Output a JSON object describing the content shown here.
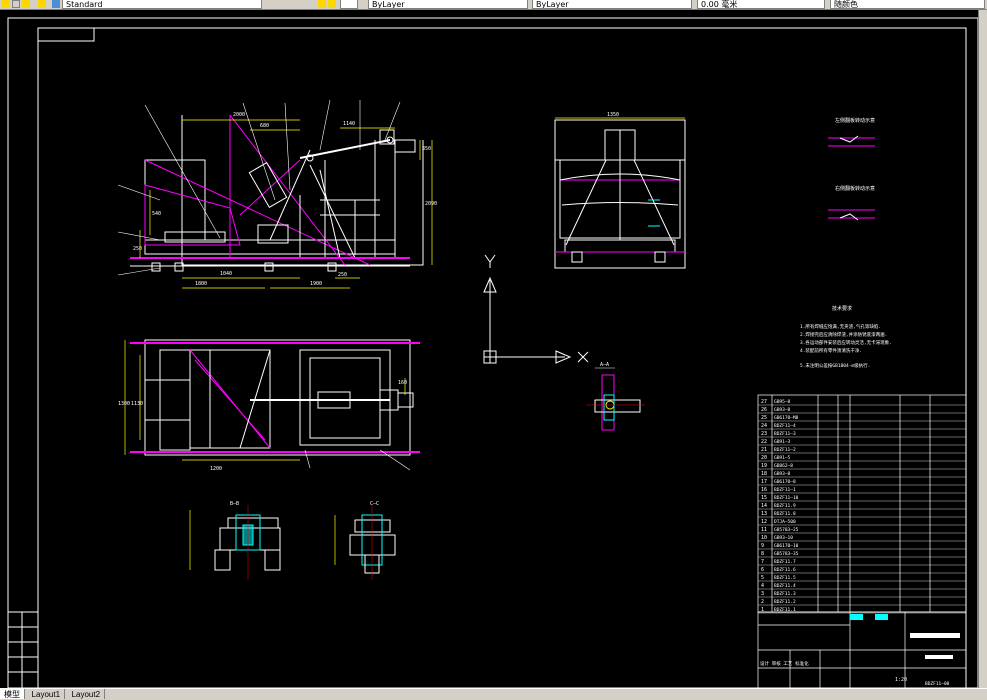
{
  "toolbar": {
    "linetype_field": "Standard",
    "layer_field": "ByLayer",
    "color_field": "ByLayer",
    "lineweight_field": "0.00 毫米",
    "plot_style_field": "随颜色"
  },
  "tabs": {
    "model": "模型",
    "layout1": "Layout1",
    "layout2": "Layout2"
  },
  "drawing": {
    "view_labels": {
      "section_aa": "A—A",
      "section_bb": "B—B",
      "section_cc": "C—C",
      "tech_req_title": "技术要求",
      "detail1_title": "左侧翻板转动示意",
      "detail2_title": "右侧翻板转动示意"
    },
    "dimensions": {
      "front_top": "2000",
      "front_mid": "680",
      "front_right": "1140",
      "front_bottom1": "1040",
      "front_bottom2": "1800",
      "front_bottom3": "1900",
      "front_bottom4": "250",
      "front_h1": "540",
      "front_h2": "250",
      "front_h3": "2090",
      "front_h4": "350",
      "side_top": "1350",
      "plan_width": "1300",
      "plan_left": "1130",
      "plan_bottom": "1200",
      "plan_right": "160"
    },
    "tech_requirements": [
      "1.所有焊缝应饱满,无夹渣,气孔等缺陷.",
      "2.焊接完后应清除焊渣,并涂防锈底漆两遍.",
      "3.各运动部件安装后应转动灵活,无卡滞现象.",
      "4.装配前所有零件须清洗干净.",
      "5.未注明公差按GB1804-m级执行."
    ],
    "bom_rows": [
      {
        "no": "27",
        "code": "GB95—8"
      },
      {
        "no": "26",
        "code": "GB93—8"
      },
      {
        "no": "25",
        "code": "GB6170—M8"
      },
      {
        "no": "24",
        "code": "BDZF11—4"
      },
      {
        "no": "23",
        "code": "BDZF11—3"
      },
      {
        "no": "22",
        "code": "GB91—3"
      },
      {
        "no": "21",
        "code": "BDZF11—2"
      },
      {
        "no": "20",
        "code": "GB91—5"
      },
      {
        "no": "19",
        "code": "GB862—8"
      },
      {
        "no": "18",
        "code": "GB93—8"
      },
      {
        "no": "17",
        "code": "GB6170—8"
      },
      {
        "no": "16",
        "code": "BDZF11—1"
      },
      {
        "no": "15",
        "code": "BDZF11—10"
      },
      {
        "no": "14",
        "code": "BDZF11.9"
      },
      {
        "no": "13",
        "code": "BDZF11.8"
      },
      {
        "no": "12",
        "code": "DTJA—500"
      },
      {
        "no": "11",
        "code": "GB5783—25"
      },
      {
        "no": "10",
        "code": "GB93—10"
      },
      {
        "no": "9",
        "code": "GB6170—10"
      },
      {
        "no": "8",
        "code": "GB5783—35"
      },
      {
        "no": "7",
        "code": "BDZF11.7"
      },
      {
        "no": "6",
        "code": "BDZF11.6"
      },
      {
        "no": "5",
        "code": "BDZF11.5"
      },
      {
        "no": "4",
        "code": "BDZF11.4"
      },
      {
        "no": "3",
        "code": "BDZF11.3"
      },
      {
        "no": "2",
        "code": "BDZF11.2"
      },
      {
        "no": "1",
        "code": "BDZF11.1"
      }
    ],
    "title_block": {
      "scale": "1:20",
      "drawing_no": "BDZF11—00",
      "company_row": "设计 审核 工艺 标准化"
    }
  },
  "colors": {
    "outline": "#ffffff",
    "magenta": "#ff00ff",
    "yellow": "#ffff00",
    "cyan": "#00ffff",
    "green": "#00ff00",
    "red": "#ff0000",
    "blue": "#0000ff",
    "ui_gray": "#d4d0c8"
  }
}
